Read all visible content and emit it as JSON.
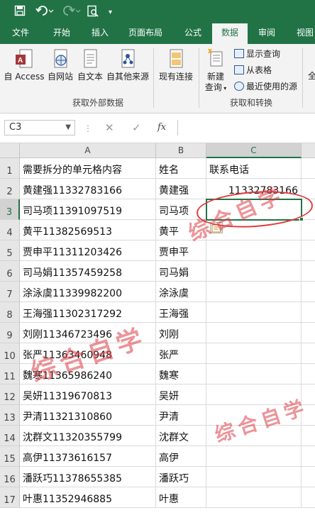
{
  "qat": {
    "save_icon": "save-icon",
    "undo_icon": "undo-icon",
    "redo_icon": "redo-icon",
    "preview_icon": "print-preview-icon",
    "more_icon": "customize-icon"
  },
  "tabs": [
    {
      "label": "文件"
    },
    {
      "label": "开始"
    },
    {
      "label": "插入"
    },
    {
      "label": "页面布局"
    },
    {
      "label": "公式"
    },
    {
      "label": "数据",
      "active": true
    },
    {
      "label": "审阅"
    },
    {
      "label": "视图"
    }
  ],
  "ribbon": {
    "access": "自 Access",
    "web": "自网站",
    "text": "自文本",
    "other": "自其他来源",
    "existing": "现有连接",
    "newquery_line1": "新建",
    "newquery_line2": "查询",
    "show_queries": "显示查询",
    "from_table": "从表格",
    "recent_sources": "最近使用的源",
    "group_external": "获取外部数据",
    "group_transform": "获取和转换",
    "clipped": "全"
  },
  "formula_bar": {
    "name_box": "C3",
    "cancel": "✕",
    "enter": "✓",
    "fx": "fx",
    "value": ""
  },
  "grid": {
    "columns": [
      "A",
      "B",
      "C"
    ],
    "selected_column": "C",
    "selected_row": 3,
    "rows": [
      {
        "n": "1",
        "a": "需要拆分的单元格内容",
        "b": "姓名",
        "c": "联系电话"
      },
      {
        "n": "2",
        "a": "黄建强11332783166",
        "b": "黄建强",
        "c": "11332783166"
      },
      {
        "n": "3",
        "a": "司马项11391097519",
        "b": "司马项",
        "c": ""
      },
      {
        "n": "4",
        "a": "黄平11382569513",
        "b": "黄平",
        "c": ""
      },
      {
        "n": "5",
        "a": "贾申平11311203426",
        "b": "贾申平",
        "c": ""
      },
      {
        "n": "6",
        "a": "司马娟11357459258",
        "b": "司马娟",
        "c": ""
      },
      {
        "n": "7",
        "a": "涂泳虞11339982200",
        "b": "涂泳虞",
        "c": ""
      },
      {
        "n": "8",
        "a": "王海强11302317292",
        "b": "王海强",
        "c": ""
      },
      {
        "n": "9",
        "a": "刘刚11346723496",
        "b": "刘刚",
        "c": ""
      },
      {
        "n": "10",
        "a": "张严11363460948",
        "b": "张严",
        "c": ""
      },
      {
        "n": "11",
        "a": "魏寒11365986240",
        "b": "魏寒",
        "c": ""
      },
      {
        "n": "12",
        "a": "吴妍11319670813",
        "b": "吴妍",
        "c": ""
      },
      {
        "n": "13",
        "a": "尹清11321310860",
        "b": "尹清",
        "c": ""
      },
      {
        "n": "14",
        "a": "沈群文11320355799",
        "b": "沈群文",
        "c": ""
      },
      {
        "n": "15",
        "a": "高伊11373616157",
        "b": "高伊",
        "c": ""
      },
      {
        "n": "16",
        "a": "潘跃巧11378655385",
        "b": "潘跃巧",
        "c": ""
      },
      {
        "n": "17",
        "a": "叶惠11352946885",
        "b": "叶惠",
        "c": ""
      }
    ]
  },
  "watermarks": [
    "综合自学",
    "综合自学",
    "综合自学"
  ],
  "colors": {
    "accent": "#217346",
    "annotation": "#e03c3c"
  }
}
